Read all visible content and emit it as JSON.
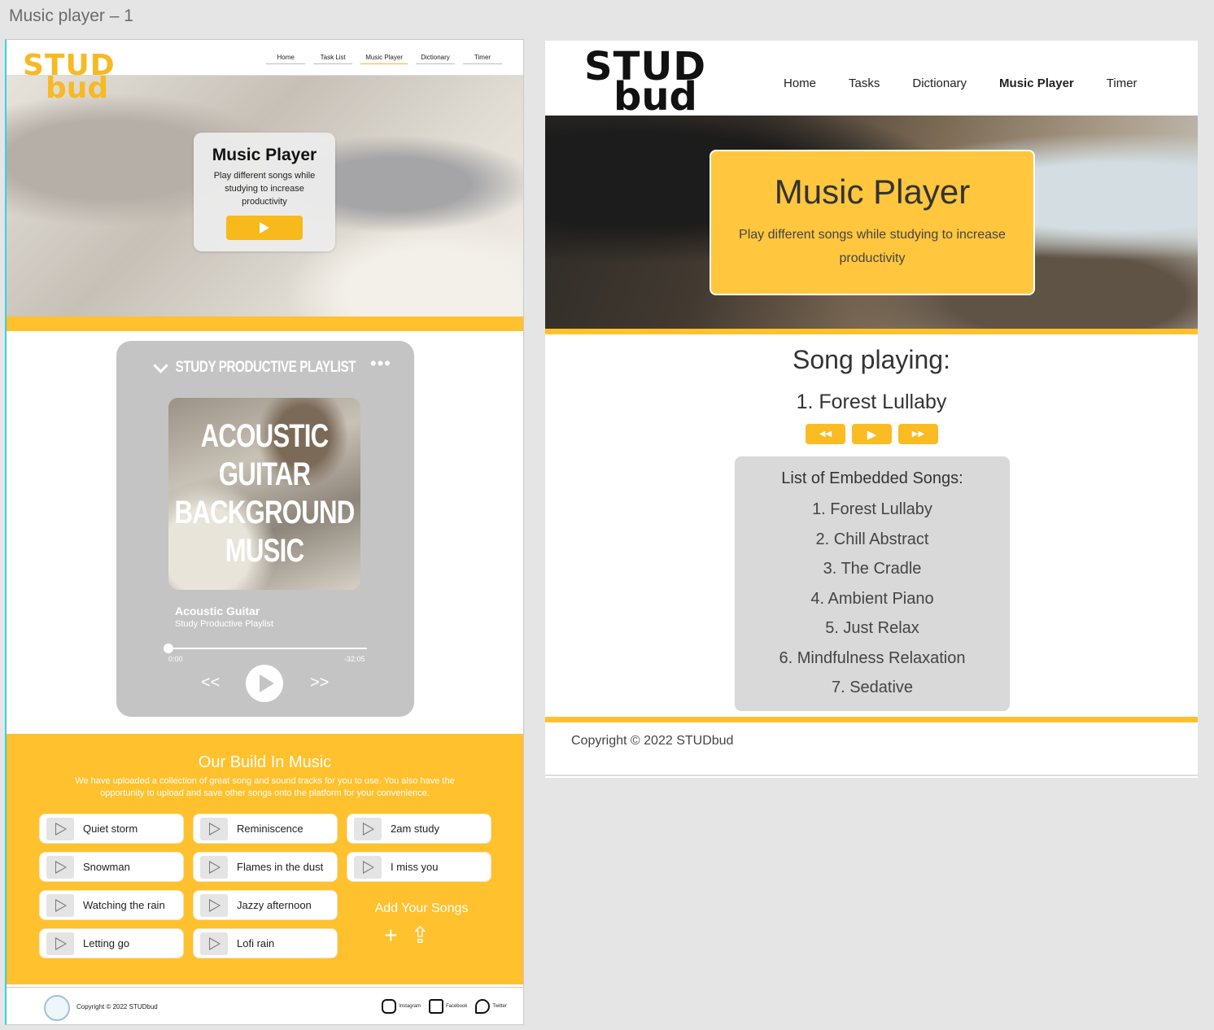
{
  "canvas": {
    "title": "Music player – 1"
  },
  "left": {
    "logo": {
      "line1": "STUD",
      "line2": "bud"
    },
    "nav": [
      {
        "label": "Home",
        "active": false
      },
      {
        "label": "Task List",
        "active": false
      },
      {
        "label": "Music Player",
        "active": true
      },
      {
        "label": "Dictionary",
        "active": false
      },
      {
        "label": "Timer",
        "active": false
      }
    ],
    "hero": {
      "title": "Music Player",
      "description": "Play different songs while studying to increase productivity"
    },
    "player": {
      "playlist_title": "STUDY PRODUCTIVE PLAYLIST",
      "menu_glyph": "•••",
      "cover_text": "ACOUSTIC GUITAR BACKGROUND MUSIC",
      "song_title": "Acoustic Guitar",
      "song_subtitle": "Study Productive Playlist",
      "progress": 0,
      "time_elapsed": "0:00",
      "time_remaining": "-32:05",
      "prev_glyph": "<<",
      "next_glyph": ">>"
    },
    "build": {
      "title": "Our Build In Music",
      "description": "We have uploaded a collection of great song and sound tracks for you to use. You also have the opportunity to upload and save other songs onto the platform for your convenience.",
      "songs": [
        "Quiet storm",
        "Reminiscence",
        "2am study",
        "Snowman",
        "Flames in the dust",
        "I miss you",
        "Watching the rain",
        "Jazzy afternoon",
        "Letting go",
        "Lofi rain"
      ],
      "add_title": "Add Your Songs",
      "add_glyph": "+",
      "upload_glyph": "⇪"
    },
    "footer": {
      "copyright": "Copyright © 2022 STUDbud",
      "social": [
        "Instagram",
        "Facebook",
        "Twitter"
      ]
    }
  },
  "right": {
    "logo": {
      "line1": "STUD",
      "line2": "bud"
    },
    "nav": [
      {
        "label": "Home",
        "bold": false
      },
      {
        "label": "Tasks",
        "bold": false
      },
      {
        "label": "Dictionary",
        "bold": false
      },
      {
        "label": "Music Player",
        "bold": true
      },
      {
        "label": "Timer",
        "bold": false
      }
    ],
    "hero": {
      "title": "Music Player",
      "description": "Play different songs while studying to increase productivity"
    },
    "now_playing_heading": "Song playing:",
    "now_playing_song": "1. Forest Lullaby",
    "controls": {
      "rewind": "◀◀",
      "play": "▶",
      "forward": "▶▶"
    },
    "list": {
      "title": "List of Embedded Songs:",
      "items": [
        "1. Forest Lullaby",
        "2. Chill Abstract",
        "3. The Cradle",
        "4. Ambient Piano",
        "5. Just Relax",
        "6. Mindfulness Relaxation",
        "7. Sedative"
      ]
    },
    "footer": {
      "copyright": "Copyright © 2022 STUDbud"
    }
  },
  "colors": {
    "accent": "#ffc12e",
    "card_gray": "#c4c4c4",
    "list_gray": "#d9d9d9"
  }
}
